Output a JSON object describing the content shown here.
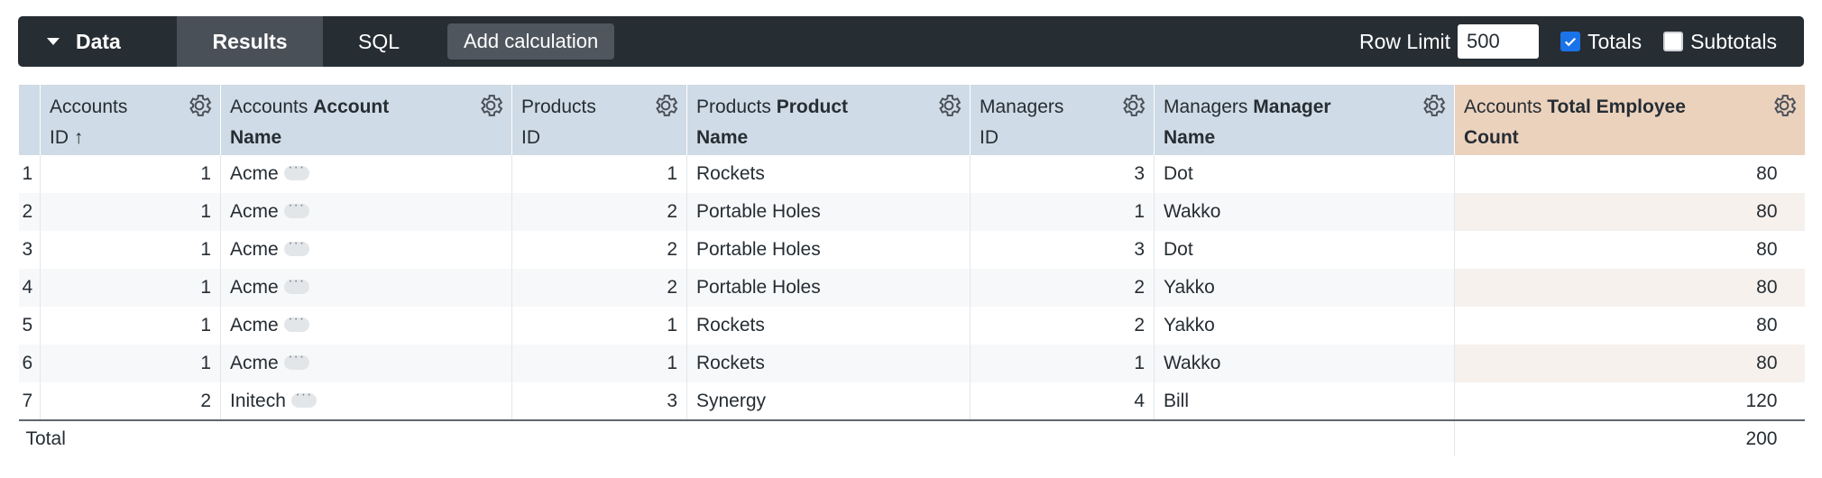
{
  "toolbar": {
    "data_tab": "Data",
    "results_tab": "Results",
    "sql_tab": "SQL",
    "add_calc": "Add calculation",
    "row_limit_label": "Row Limit",
    "row_limit_value": "500",
    "totals_label": "Totals",
    "totals_checked": true,
    "subtotals_label": "Subtotals",
    "subtotals_checked": false
  },
  "columns": [
    {
      "view": "Accounts",
      "field": "ID",
      "sort": "↑"
    },
    {
      "view": "Accounts",
      "field": "Account",
      "field2": "Name"
    },
    {
      "view": "Products",
      "field": "ID"
    },
    {
      "view": "Products",
      "field": "Product",
      "field2": "Name"
    },
    {
      "view": "Managers",
      "field": "ID"
    },
    {
      "view": "Managers",
      "field": "Manager",
      "field2": "Name"
    },
    {
      "view": "Accounts",
      "field": "Total Employee",
      "field2": "Count"
    }
  ],
  "rows": [
    {
      "n": "1",
      "acc_id": "1",
      "acc_name": "Acme",
      "prod_id": "1",
      "prod_name": "Rockets",
      "mgr_id": "3",
      "mgr_name": "Dot",
      "emp": "80"
    },
    {
      "n": "2",
      "acc_id": "1",
      "acc_name": "Acme",
      "prod_id": "2",
      "prod_name": "Portable Holes",
      "mgr_id": "1",
      "mgr_name": "Wakko",
      "emp": "80"
    },
    {
      "n": "3",
      "acc_id": "1",
      "acc_name": "Acme",
      "prod_id": "2",
      "prod_name": "Portable Holes",
      "mgr_id": "3",
      "mgr_name": "Dot",
      "emp": "80"
    },
    {
      "n": "4",
      "acc_id": "1",
      "acc_name": "Acme",
      "prod_id": "2",
      "prod_name": "Portable Holes",
      "mgr_id": "2",
      "mgr_name": "Yakko",
      "emp": "80"
    },
    {
      "n": "5",
      "acc_id": "1",
      "acc_name": "Acme",
      "prod_id": "1",
      "prod_name": "Rockets",
      "mgr_id": "2",
      "mgr_name": "Yakko",
      "emp": "80"
    },
    {
      "n": "6",
      "acc_id": "1",
      "acc_name": "Acme",
      "prod_id": "1",
      "prod_name": "Rockets",
      "mgr_id": "1",
      "mgr_name": "Wakko",
      "emp": "80"
    },
    {
      "n": "7",
      "acc_id": "2",
      "acc_name": "Initech",
      "prod_id": "3",
      "prod_name": "Synergy",
      "mgr_id": "4",
      "mgr_name": "Bill",
      "emp": "120"
    }
  ],
  "totals": {
    "label": "Total",
    "emp": "200"
  },
  "colors": {
    "toolbar_bg": "#262d33",
    "dimension_header": "#cfdbe6",
    "measure_header": "#ebd2bd",
    "checkbox_on": "#1a73e8"
  }
}
